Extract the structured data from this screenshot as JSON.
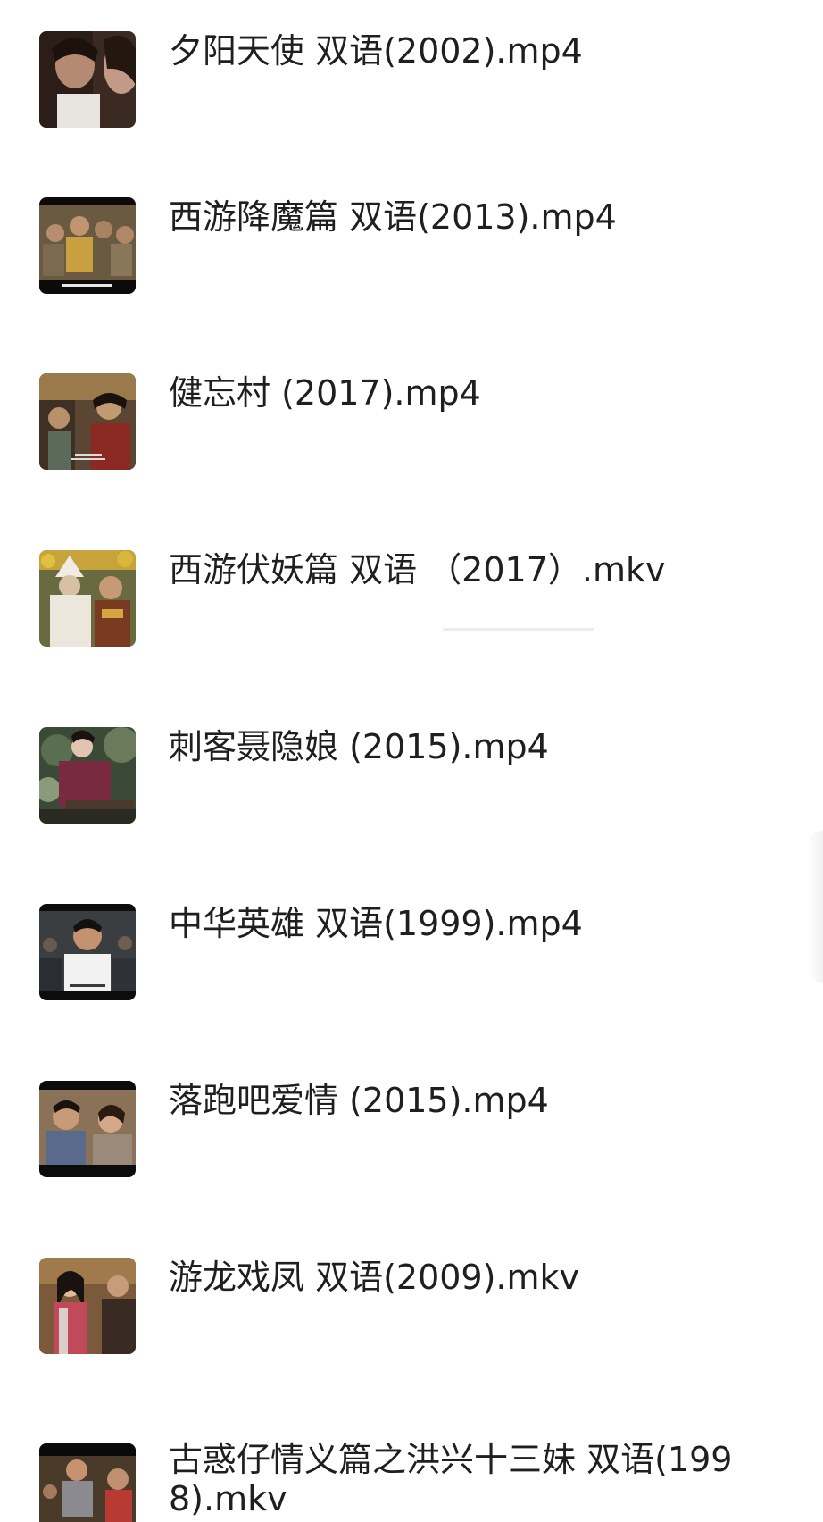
{
  "files": [
    {
      "name": "夕阳天使 双语(2002).mp4",
      "thumb_icon": "video-thumbnail-icon"
    },
    {
      "name": "西游降魔篇 双语(2013).mp4",
      "thumb_icon": "video-thumbnail-icon"
    },
    {
      "name": "健忘村 (2017).mp4",
      "thumb_icon": "video-thumbnail-icon"
    },
    {
      "name": "西游伏妖篇 双语 （2017）.mkv",
      "thumb_icon": "video-thumbnail-icon"
    },
    {
      "name": "刺客聂隐娘 (2015).mp4",
      "thumb_icon": "video-thumbnail-icon"
    },
    {
      "name": "中华英雄 双语(1999).mp4",
      "thumb_icon": "video-thumbnail-icon"
    },
    {
      "name": "落跑吧爱情 (2015).mp4",
      "thumb_icon": "video-thumbnail-icon"
    },
    {
      "name": "游龙戏凤 双语(2009).mkv",
      "thumb_icon": "video-thumbnail-icon"
    },
    {
      "name": "古惑仔情义篇之洪兴十三妹 双语(1998).mkv",
      "thumb_icon": "video-thumbnail-icon"
    }
  ],
  "colors": {
    "text": "#1f1f1f",
    "background": "#ffffff"
  }
}
